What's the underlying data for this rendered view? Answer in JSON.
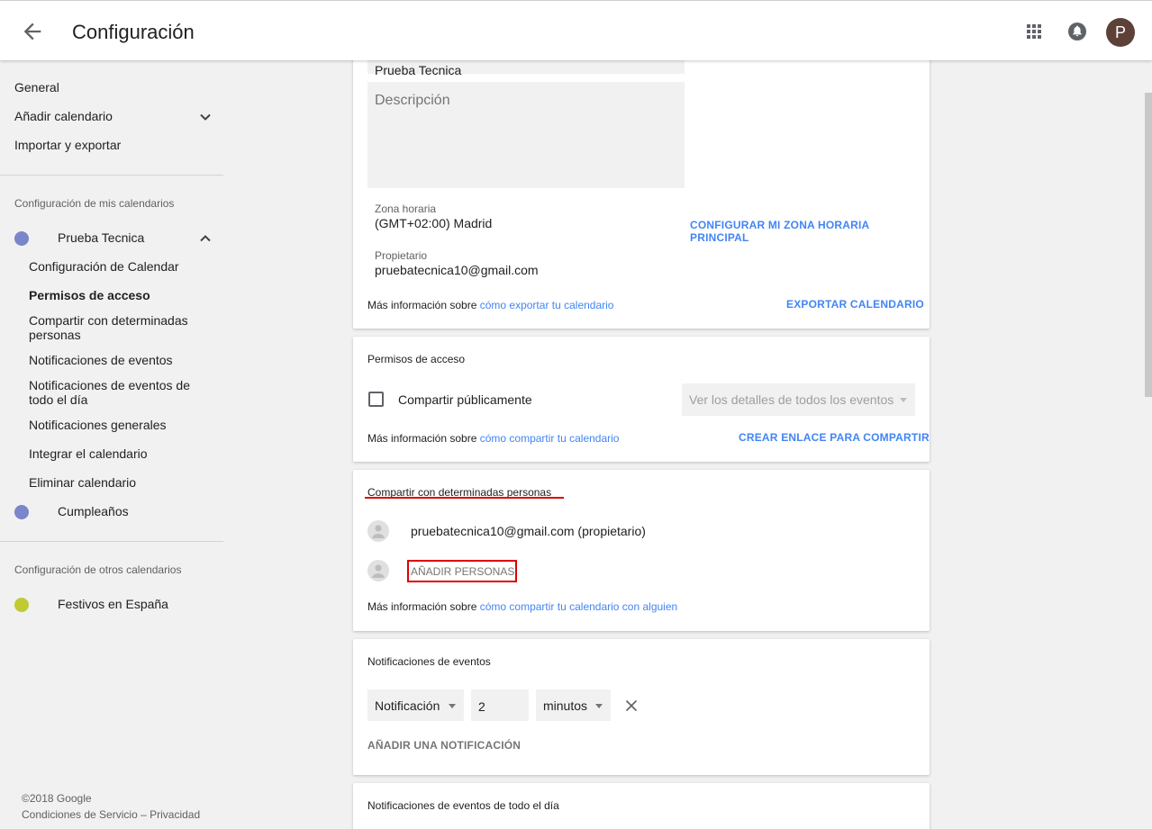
{
  "header": {
    "title": "Configuración",
    "avatar_letter": "P"
  },
  "sidebar": {
    "general": "General",
    "add_calendar": "Añadir calendario",
    "import_export": "Importar y exportar",
    "my_calendars_label": "Configuración de mis calendarios",
    "calendars": [
      {
        "name": "Prueba Tecnica",
        "color": "#7986cb"
      },
      {
        "name": "Cumpleaños",
        "color": "#7986cb"
      }
    ],
    "sub_items": [
      "Configuración de Calendar",
      "Permisos de acceso",
      "Compartir con determinadas personas",
      "Notificaciones de eventos",
      "Notificaciones de eventos de todo el día",
      "Notificaciones generales",
      "Integrar el calendario",
      "Eliminar calendario"
    ],
    "other_calendars_label": "Configuración de otros calendarios",
    "other_calendars": [
      {
        "name": "Festivos en España",
        "color": "#c0ca33"
      }
    ],
    "footer": {
      "copyright": "©2018 Google",
      "terms": "Condiciones de Servicio",
      "separator": "–",
      "privacy": "Privacidad"
    }
  },
  "calendar_card": {
    "name_value": "Prueba Tecnica",
    "description_placeholder": "Descripción",
    "timezone_label": "Zona horaria",
    "timezone_value": "(GMT+02:00) Madrid",
    "timezone_button": "CONFIGURAR MI ZONA HORARIA PRINCIPAL",
    "owner_label": "Propietario",
    "owner_value": "pruebatecnica10@gmail.com",
    "info_prefix": "Más información sobre",
    "info_link": "cómo exportar tu calendario",
    "export_button": "EXPORTAR CALENDARIO"
  },
  "access_card": {
    "title": "Permisos de acceso",
    "public_checkbox_label": "Compartir públicamente",
    "visibility_select": "Ver los detalles de todos los eventos",
    "info_prefix": "Más información sobre",
    "info_link": "cómo compartir tu calendario",
    "link_button": "CREAR ENLACE PARA COMPARTIR"
  },
  "share_card": {
    "title": "Compartir con determinadas personas",
    "owner_entry": "pruebatecnica10@gmail.com (propietario)",
    "add_people_button": "AÑADIR PERSONAS",
    "info_prefix": "Más información sobre",
    "info_link": "cómo compartir tu calendario con alguien",
    "annotation_color": "#e00000"
  },
  "notifications_card": {
    "title": "Notificaciones de eventos",
    "type_select": "Notificación",
    "amount_value": "2",
    "unit_select": "minutos",
    "add_button": "AÑADIR UNA NOTIFICACIÓN"
  },
  "allday_card": {
    "title": "Notificaciones de eventos de todo el día"
  },
  "colors": {
    "accent": "#4285f4",
    "avatar_bg": "#5d4037"
  }
}
